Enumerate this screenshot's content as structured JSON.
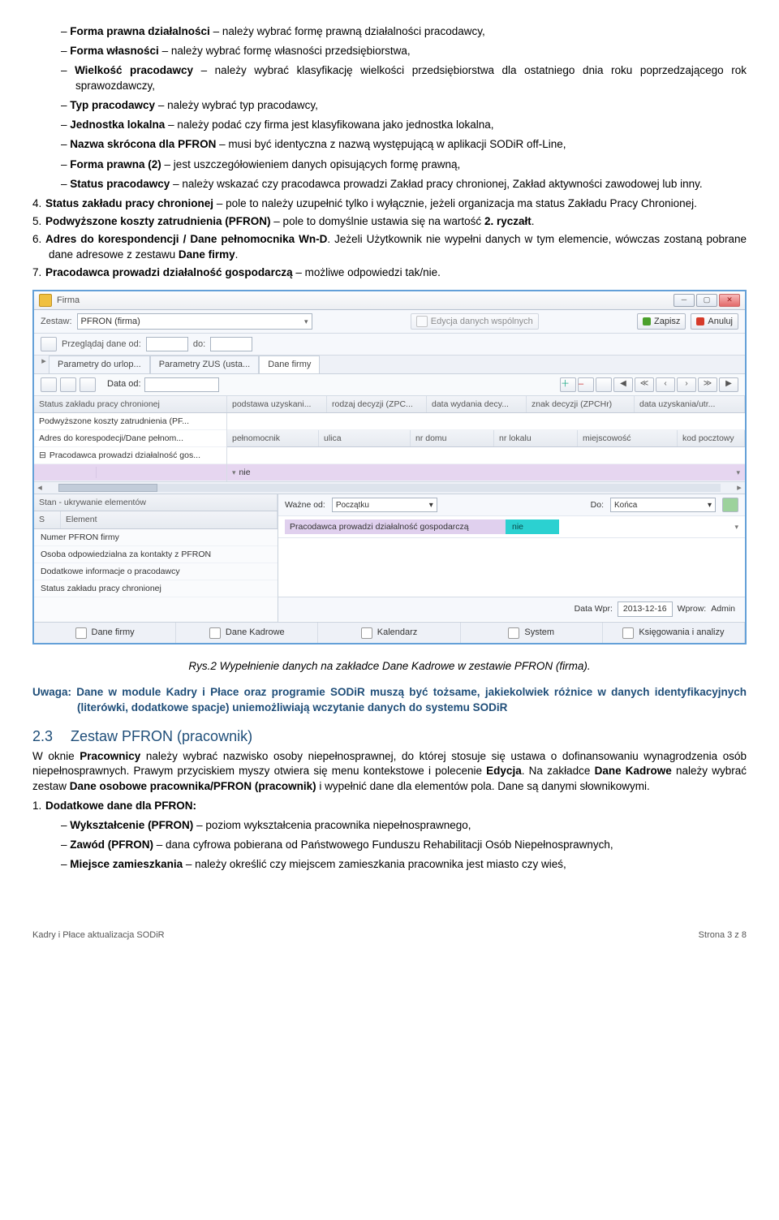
{
  "bullets_top": [
    {
      "b": "Forma prawna działalności",
      "t": " – należy wybrać formę prawną działalności pracodawcy,"
    },
    {
      "b": "Forma własności",
      "t": " – należy wybrać formę własności przedsiębiorstwa,"
    },
    {
      "b": "Wielkość pracodawcy",
      "t": " – należy wybrać klasyfikację wielkości przedsiębiorstwa dla ostatniego dnia roku poprzedzającego rok sprawozdawczy,"
    },
    {
      "b": "Typ pracodawcy",
      "t": " – należy wybrać typ pracodawcy,"
    },
    {
      "b": "Jednostka lokalna",
      "t": " – należy podać czy firma jest klasyfikowana jako jednostka lokalna,"
    },
    {
      "b": "Nazwa skrócona dla PFRON",
      "t": " – musi być identyczna z nazwą występującą w aplikacji SODiR off-Line,"
    },
    {
      "b": "Forma prawna (2)",
      "t": " – jest uszczegółowieniem danych opisujących formę prawną,"
    },
    {
      "b": "Status pracodawcy",
      "t": " – należy wskazać czy pracodawca prowadzi Zakład pracy chronionej, Zakład aktywności zawodowej lub inny."
    }
  ],
  "num4to7": [
    {
      "n": "4.",
      "b": "Status zakładu pracy chronionej",
      "t": " – pole to należy uzupełnić tylko i wyłącznie, jeżeli organizacja ma status Zakładu Pracy Chronionej."
    },
    {
      "n": "5.",
      "b": "Podwyższone koszty zatrudnienia (PFRON)",
      "t": " – pole to domyślnie ustawia się na wartość ",
      "b2": "2. ryczałt",
      "t2": "."
    },
    {
      "n": "6.",
      "b": "Adres do korespondencji / Dane pełnomocnika Wn-D",
      "t": ". Jeżeli Użytkownik nie wypełni danych w tym elemencie, wówczas zostaną pobrane dane adresowe z zestawu ",
      "b2": "Dane firmy",
      "t2": "."
    },
    {
      "n": "7.",
      "b": "Pracodawca prowadzi działalność gospodarczą",
      "t": " – możliwe odpowiedzi tak/nie."
    }
  ],
  "figcaption": "Rys.2 Wypełnienie danych na zakładce Dane Kadrowe w zestawie PFRON (firma).",
  "warning": "Uwaga: Dane w module Kadry i Płace oraz programie SODiR muszą być tożsame, jakiekolwiek różnice w danych identyfikacyjnych (literówki, dodatkowe spacje) uniemożliwiają wczytanie danych do systemu SODiR",
  "section": {
    "num": "2.3",
    "title": "Zestaw PFRON (pracownik)"
  },
  "section_body": [
    "W oknie Pracownicy należy wybrać nazwisko osoby niepełnosprawnej, do której stosuje się ustawa o dofinansowaniu wynagrodzenia osób niepełnosprawnych. Prawym przyciskiem myszy otwiera się menu kontekstowe i polecenie Edycja. Na zakładce Dane Kadrowe należy wybrać zestaw Dane osobowe pracownika/PFRON (pracownik) i wypełnić dane dla elementów pola. Dane są danymi słownikowymi."
  ],
  "num1": {
    "n": "1.",
    "b": "Dodatkowe dane dla PFRON:"
  },
  "bullets_bottom": [
    {
      "b": "Wykształcenie (PFRON)",
      "t": " – poziom wykształcenia pracownika niepełnosprawnego,"
    },
    {
      "b": "Zawód (PFRON)",
      "t": " – dana cyfrowa pobierana od Państwowego Funduszu Rehabilitacji Osób Niepełnosprawnych,"
    },
    {
      "b": "Miejsce zamieszkania",
      "t": " – należy określić czy miejscem zamieszkania pracownika jest miasto czy wieś,"
    }
  ],
  "footer": {
    "left": "Kadry i Płace aktualizacja SODiR",
    "right": "Strona 3 z 8"
  },
  "app": {
    "title": "Firma",
    "zestaw_label": "Zestaw:",
    "zestaw_value": "PFRON (firma)",
    "edycja": "Edycja danych wspólnych",
    "zapisz": "Zapisz",
    "anuluj": "Anuluj",
    "przegladaj": "Przeglądaj dane od:",
    "do": "do:",
    "tabs": [
      "Parametry do urlop...",
      "Parametry ZUS (usta...",
      "Dane firmy"
    ],
    "dataod": "Data od:",
    "nav": [
      "◀",
      "≪",
      "‹",
      "›",
      "≫",
      "▶"
    ],
    "headers1": [
      "Status zakładu pracy chronionej",
      "podstawa uzyskani...",
      "rodzaj decyzji (ZPC...",
      "data wydania decy...",
      "znak decyzji (ZPCHr)",
      "data uzyskania/utr..."
    ],
    "headers2": [
      "Podwyższone koszty zatrudnienia (PF..."
    ],
    "headers3_left": "Adres do korespodecji/Dane pełnom...",
    "headers3": [
      "pełnomocnik",
      "ulica",
      "nr domu",
      "nr lokalu",
      "miejscowość",
      "kod pocztowy"
    ],
    "headers4_left": "Pracodawca prowadzi działalność gos...",
    "purple_nie": "nie",
    "stan_label": "Stan - ukrywanie elementów",
    "cols_se": [
      "S",
      "Element"
    ],
    "left_items": [
      "Numer PFRON firmy",
      "Osoba odpowiedzialna za kontakty z PFRON",
      "Dodatkowe informacje o pracodawcy",
      "Status zakładu pracy chronionej"
    ],
    "wazne_od": "Ważne od:",
    "poczatku": "Początku",
    "do2": "Do:",
    "konca": "Końca",
    "highlight_label": "Pracodawca prowadzi działalność gospodarczą",
    "highlight_val": "nie",
    "datawpr": "Data Wpr:",
    "datawpr_val": "2013-12-16",
    "wprow": "Wprow:",
    "admin": "Admin",
    "btabs": [
      "Dane firmy",
      "Dane Kadrowe",
      "Kalendarz",
      "System",
      "Księgowania i analizy"
    ]
  }
}
